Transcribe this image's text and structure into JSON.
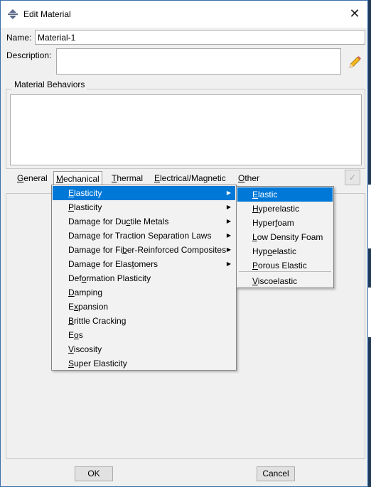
{
  "window": {
    "title": "Edit Material",
    "close_glyph": "✕"
  },
  "fields": {
    "name_label": "Name:",
    "name_value": "Material-1",
    "description_label": "Description:",
    "description_value": ""
  },
  "material_behaviors": {
    "title": "Material Behaviors",
    "items": []
  },
  "menubar": [
    {
      "mnemonic": "G",
      "rest": "eneral"
    },
    {
      "mnemonic": "M",
      "rest": "echanical"
    },
    {
      "mnemonic": "T",
      "rest": "hermal"
    },
    {
      "mnemonic": "E",
      "rest": "lectrical/Magnetic"
    },
    {
      "mnemonic": "O",
      "rest": "ther"
    }
  ],
  "mechanical_menu": [
    {
      "pre": "",
      "u": "E",
      "post": "lasticity",
      "submenu": true,
      "highlighted": true
    },
    {
      "pre": "",
      "u": "P",
      "post": "lasticity",
      "submenu": true
    },
    {
      "pre": "Damage for Du",
      "u": "c",
      "post": "tile Metals",
      "submenu": true
    },
    {
      "pre": "Dama",
      "u": "g",
      "post": "e for Traction Separation Laws",
      "submenu": true
    },
    {
      "pre": "Damage for Fi",
      "u": "b",
      "post": "er-Reinforced Composites",
      "submenu": true
    },
    {
      "pre": "Damage for Elas",
      "u": "t",
      "post": "omers",
      "submenu": true
    },
    {
      "pre": "Def",
      "u": "o",
      "post": "rmation Plasticity",
      "submenu": false
    },
    {
      "pre": "",
      "u": "D",
      "post": "amping",
      "submenu": false
    },
    {
      "pre": "E",
      "u": "x",
      "post": "pansion",
      "submenu": false
    },
    {
      "pre": "",
      "u": "B",
      "post": "rittle Cracking",
      "submenu": false
    },
    {
      "pre": "E",
      "u": "o",
      "post": "s",
      "submenu": false
    },
    {
      "pre": "",
      "u": "V",
      "post": "iscosity",
      "submenu": false
    },
    {
      "pre": "",
      "u": "S",
      "post": "uper Elasticity",
      "submenu": false
    }
  ],
  "elasticity_submenu": [
    {
      "pre": "",
      "u": "E",
      "post": "lastic",
      "highlighted": true
    },
    {
      "pre": "",
      "u": "H",
      "post": "yperelastic"
    },
    {
      "pre": "Hyper",
      "u": "f",
      "post": "oam"
    },
    {
      "pre": "",
      "u": "L",
      "post": "ow Density Foam"
    },
    {
      "pre": "Hyp",
      "u": "o",
      "post": "elastic"
    },
    {
      "pre": "",
      "u": "P",
      "post": "orous Elastic"
    },
    {
      "pre": "",
      "u": "V",
      "post": "iscoelastic",
      "separator_before": true
    }
  ],
  "buttons": {
    "ok": "OK",
    "cancel": "Cancel"
  },
  "colors": {
    "highlight": "#0078d7",
    "window_bg": "#f0f0f0",
    "desktop": "#1e3c5a"
  }
}
